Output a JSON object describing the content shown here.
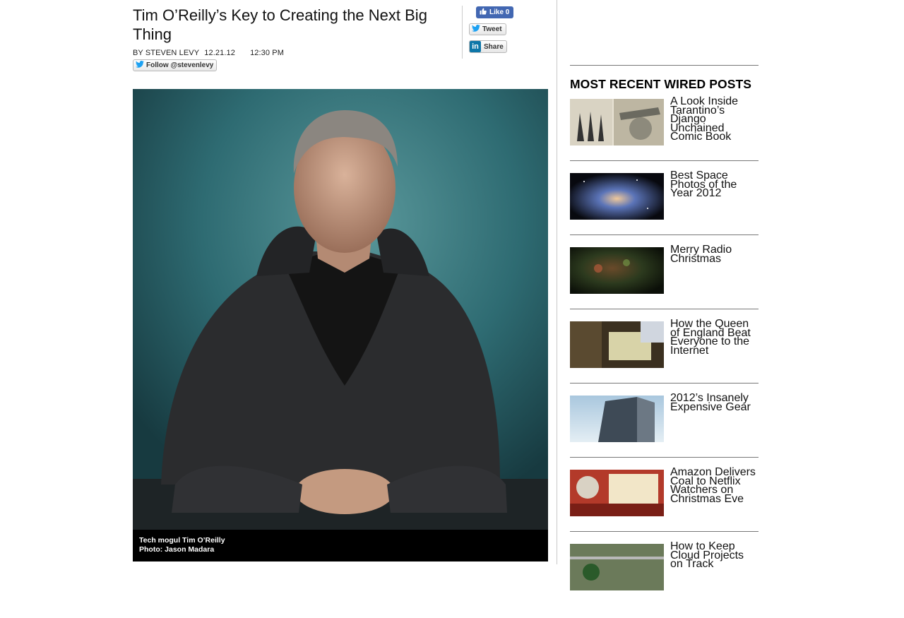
{
  "article": {
    "title": "Tim O’Reilly’s Key to Creating the Next Big Thing",
    "byline": "BY STEVEN LEVY",
    "date": "12.21.12",
    "time": "12:30 PM",
    "follow_label": "Follow @stevenlevy"
  },
  "share": {
    "like_label": "Like 0",
    "tweet_label": "Tweet",
    "linkedin_logo": "in",
    "linkedin_label": "Share"
  },
  "photo": {
    "caption_line1": "Tech mogul Tim O’Reilly",
    "caption_line2": "Photo: Jason Madara"
  },
  "sidebar": {
    "heading": "MOST RECENT WIRED POSTS",
    "posts": [
      {
        "title": "A Look Inside Tarantino’s Django Unchained Comic Book"
      },
      {
        "title": "Best Space Photos of the Year 2012"
      },
      {
        "title": "Merry Radio Christmas"
      },
      {
        "title": "How the Queen of England Beat Everyone to the Internet"
      },
      {
        "title": "2012’s Insanely Expensive Gear"
      },
      {
        "title": "Amazon Delivers Coal to Netflix Watchers on Christmas Eve"
      },
      {
        "title": "How to Keep Cloud Projects on Track"
      }
    ]
  },
  "colors": {
    "facebook": "#4267b2",
    "linkedin": "#0e76a8",
    "twitter": "#1da1f2"
  }
}
